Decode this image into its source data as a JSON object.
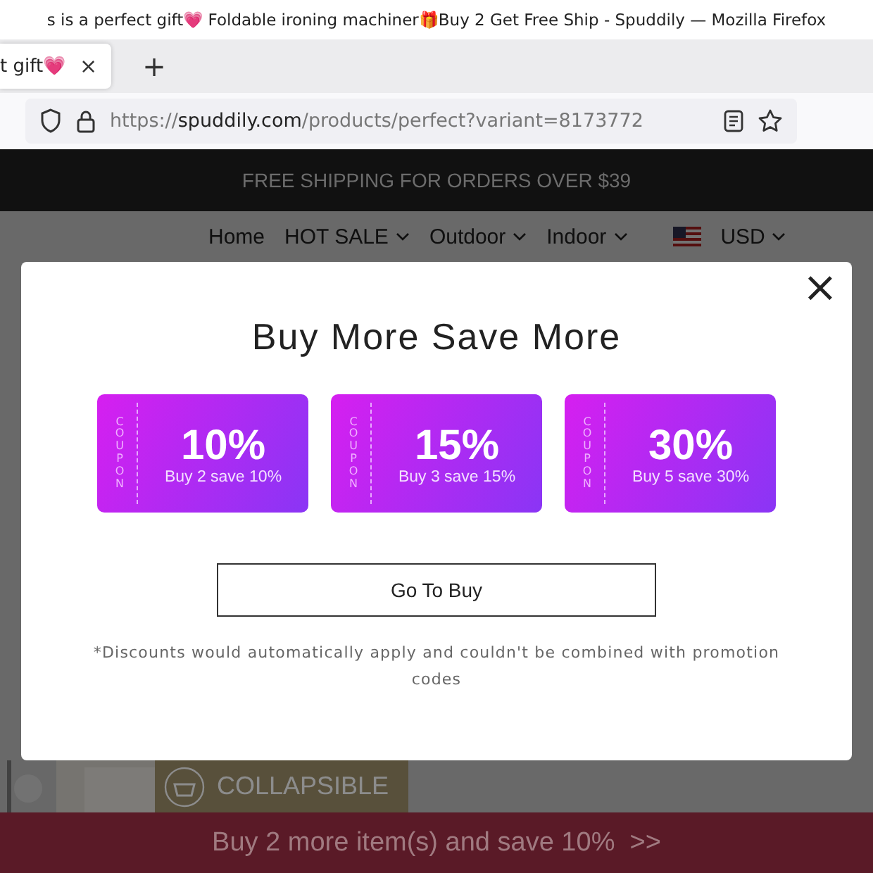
{
  "window": {
    "title": "s is a perfect gift💗 Foldable ironing machiner🎁Buy 2 Get Free Ship - Spuddily — Mozilla Firefox"
  },
  "tabs": [
    {
      "label": "t gift💗",
      "selected": true,
      "close": "×"
    }
  ],
  "new_tab": "+",
  "address_bar": {
    "scheme": "https://",
    "host": "spuddily.com",
    "path": "/products/perfect?variant=8173772"
  },
  "announcement": "FREE SHIPPING FOR ORDERS OVER $39",
  "nav": {
    "items": [
      {
        "label": "Home",
        "dropdown": false
      },
      {
        "label": "HOT SALE",
        "dropdown": true
      },
      {
        "label": "Outdoor",
        "dropdown": true
      },
      {
        "label": "Indoor",
        "dropdown": true
      }
    ],
    "currency": "USD"
  },
  "product_badge": "COLLAPSIBLE",
  "modal": {
    "close": "×",
    "title": "Buy More Save More",
    "coupons": [
      {
        "side": "COUPON",
        "amount": "10%",
        "caption": "Buy 2 save 10%"
      },
      {
        "side": "COUPON",
        "amount": "15%",
        "caption": "Buy 3 save 15%"
      },
      {
        "side": "COUPON",
        "amount": "30%",
        "caption": "Buy 5 save 30%"
      }
    ],
    "button": "Go To Buy",
    "note": "*Discounts would automatically apply and couldn't be combined with promotion codes"
  },
  "cart_bar": "Buy 2 more item(s) and save 10%  >>"
}
